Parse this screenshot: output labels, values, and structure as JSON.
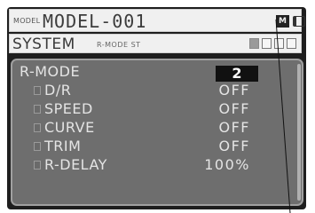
{
  "header": {
    "model_badge": "MODEL",
    "model_name": "MODEL-001",
    "hold_indicator": "M"
  },
  "menu": {
    "title": "SYSTEM",
    "subtitle": "R-MODE ST",
    "pages": [
      {
        "active": true
      },
      {
        "active": false
      },
      {
        "active": false
      },
      {
        "active": false
      }
    ]
  },
  "rmode": {
    "label": "R-MODE",
    "value": "2"
  },
  "items": [
    {
      "label": "D/R",
      "value": "OFF"
    },
    {
      "label": "SPEED",
      "value": "OFF"
    },
    {
      "label": "CURVE",
      "value": "OFF"
    },
    {
      "label": "TRIM",
      "value": "OFF"
    },
    {
      "label": "R-DELAY",
      "value": "100%"
    }
  ],
  "icons": {
    "battery": "battery-icon",
    "hold": "hold-indicator-icon",
    "checkbox": "checkbox-icon"
  },
  "colors": {
    "panel_bg": "#6e6e6e",
    "header_bg": "#f0f0f0",
    "lcd_bg": "#1e1e1e",
    "text_light": "#e4e4e4",
    "highlight_bg": "#111111"
  }
}
